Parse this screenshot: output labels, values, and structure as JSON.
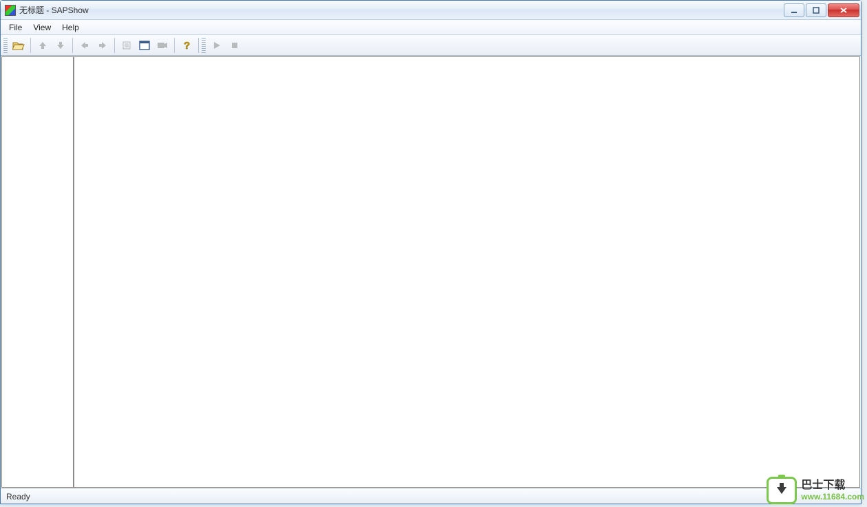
{
  "window": {
    "title": "无标题 - SAPShow"
  },
  "menu": {
    "items": [
      "File",
      "View",
      "Help"
    ]
  },
  "toolbar": {
    "open": "open-icon",
    "up": "up-arrow-icon",
    "down": "down-arrow-icon",
    "back": "back-arrow-icon",
    "forward": "forward-arrow-icon",
    "list": "list-icon",
    "fullscreen": "fullscreen-icon",
    "record": "camera-icon",
    "help": "help-icon",
    "play": "play-icon",
    "stop": "stop-icon"
  },
  "status": {
    "text": "Ready"
  },
  "watermark": {
    "label": "巴士下载",
    "url": "www.11684.com"
  }
}
